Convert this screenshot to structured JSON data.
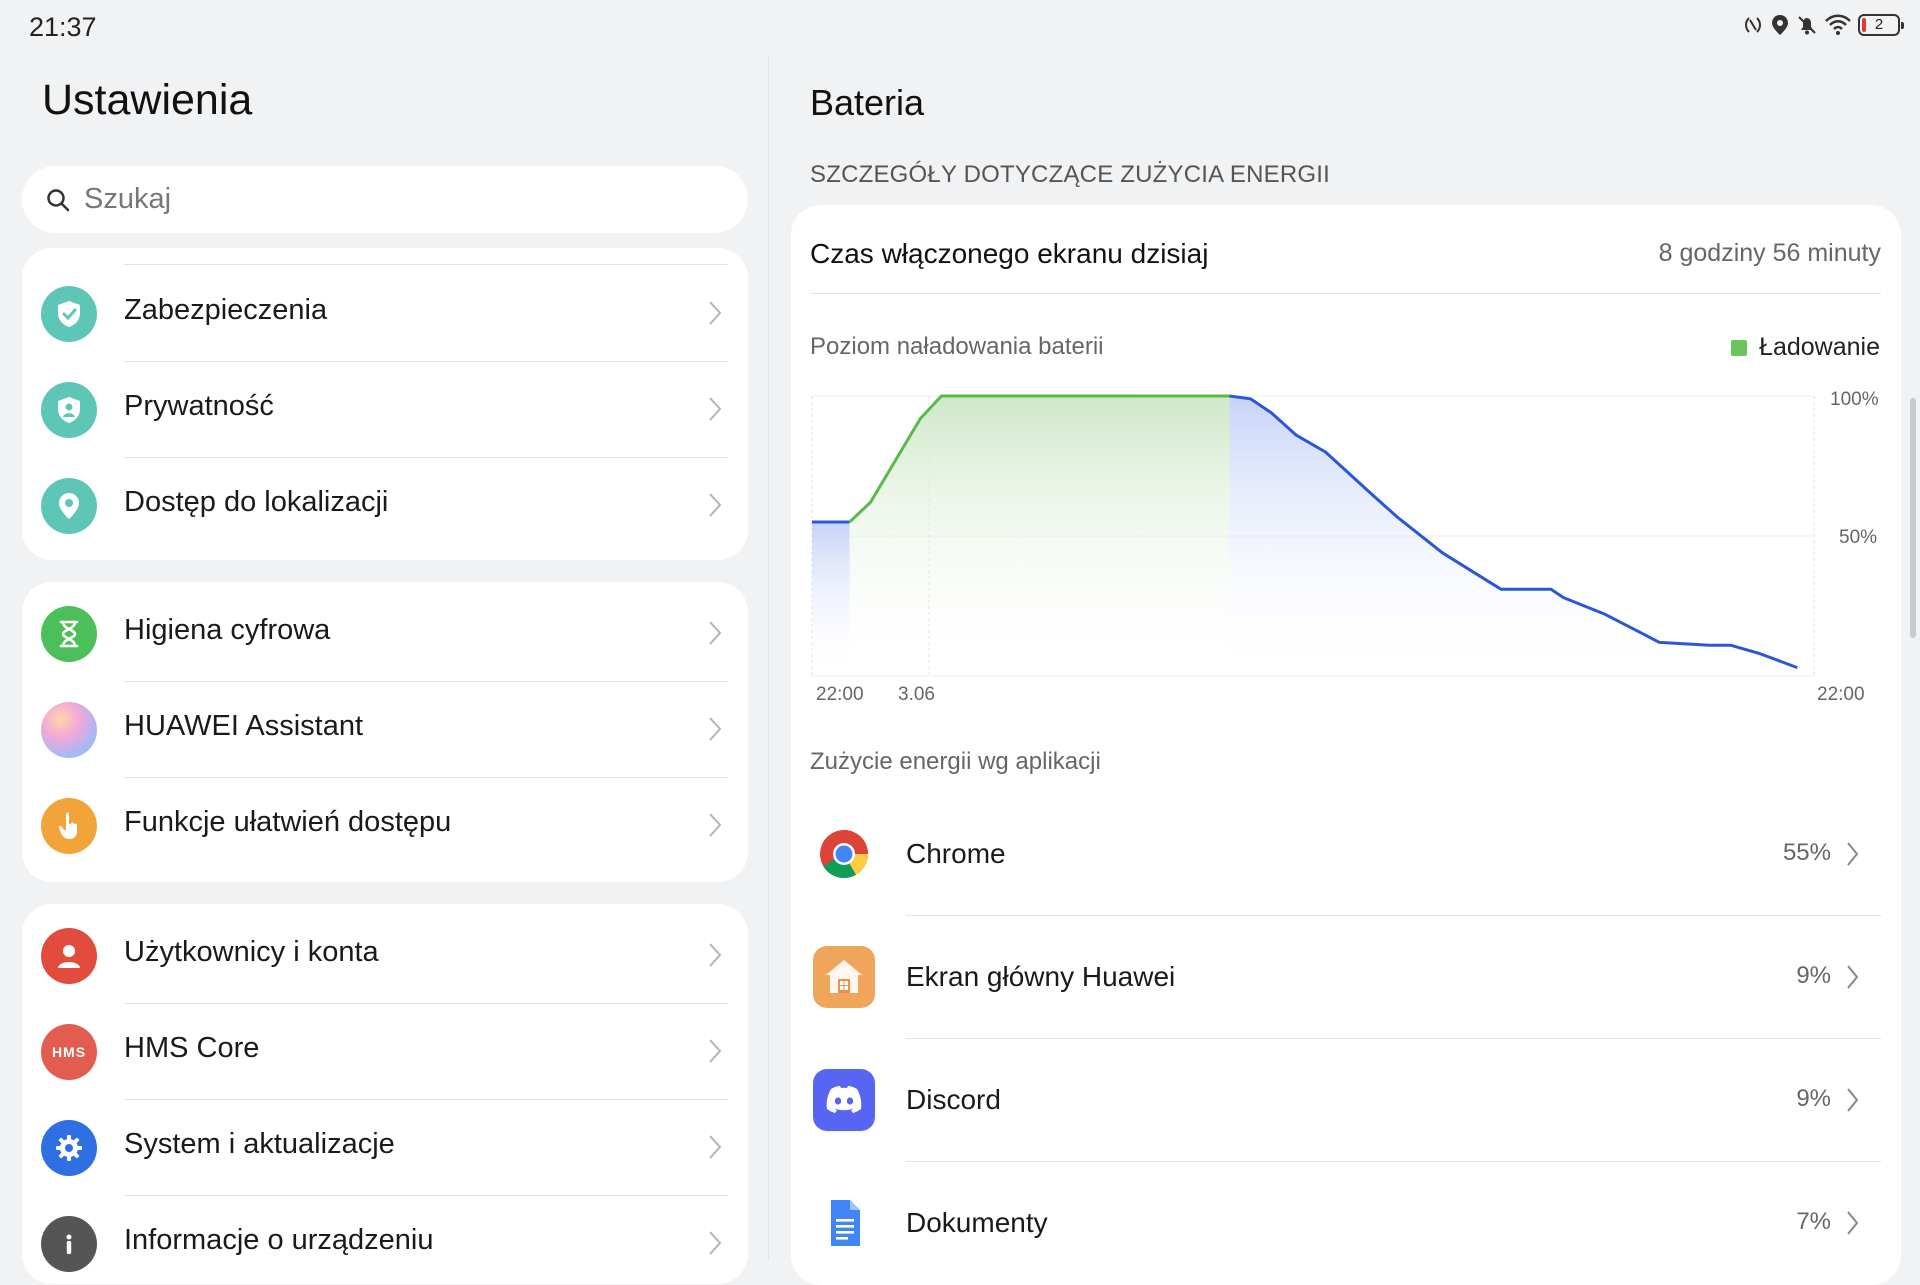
{
  "status": {
    "time": "21:37",
    "battery_level": "2",
    "icons": [
      "nfc-icon",
      "location-icon",
      "mute-icon",
      "wifi-icon",
      "battery-icon"
    ]
  },
  "left": {
    "title": "Ustawienia",
    "search_placeholder": "Szukaj",
    "groups": [
      [
        {
          "label": "Zabezpieczenia",
          "icon": "shield-check-icon",
          "color": "#5ec6b7"
        },
        {
          "label": "Prywatność",
          "icon": "privacy-shield-icon",
          "color": "#5ec6b7"
        },
        {
          "label": "Dostęp do lokalizacji",
          "icon": "location-pin-icon",
          "color": "#5ec6b7"
        }
      ],
      [
        {
          "label": "Higiena cyfrowa",
          "icon": "hourglass-icon",
          "color": "#4dbf5a"
        },
        {
          "label": "HUAWEI Assistant",
          "icon": "assistant-orb-icon",
          "color": "#c9b6f2"
        },
        {
          "label": "Funkcje ułatwień dostępu",
          "icon": "hand-icon",
          "color": "#f2a43a"
        }
      ],
      [
        {
          "label": "Użytkownicy i konta",
          "icon": "user-icon",
          "color": "#e24c3e"
        },
        {
          "label": "HMS Core",
          "icon": "hms-icon",
          "color": "#e24c3e"
        },
        {
          "label": "System i aktualizacje",
          "icon": "gear-icon",
          "color": "#2f6fe4"
        },
        {
          "label": "Informacje o urządzeniu",
          "icon": "info-icon",
          "color": "#555555"
        }
      ]
    ]
  },
  "right": {
    "title": "Bateria",
    "section_header": "SZCZEGÓŁY DOTYCZĄCE ZUŻYCIA ENERGII",
    "screen_time_label": "Czas włączonego ekranu dzisiaj",
    "screen_time_value": "8 godziny 56 minuty",
    "chart_title": "Poziom naładowania baterii",
    "legend_label": "Ładowanie",
    "apps_header": "Zużycie energii wg aplikacji",
    "apps": [
      {
        "name": "Chrome",
        "percent": "55%",
        "icon": "chrome-icon"
      },
      {
        "name": "Ekran główny Huawei",
        "percent": "9%",
        "icon": "home-icon"
      },
      {
        "name": "Discord",
        "percent": "9%",
        "icon": "discord-icon"
      },
      {
        "name": "Dokumenty",
        "percent": "7%",
        "icon": "docs-icon"
      }
    ]
  },
  "chart_data": {
    "type": "area",
    "title": "Poziom naładowania baterii",
    "legend": [
      "Ładowanie"
    ],
    "x_tick_labels": [
      "22:00",
      "3.06",
      "22:00"
    ],
    "y_tick_labels": [
      "100%",
      "50%"
    ],
    "ylim": [
      0,
      100
    ],
    "x_hours": [
      0,
      0.9,
      1.4,
      2.6,
      3.1,
      10.0,
      10.5,
      11.0,
      11.6,
      12.3,
      13.4,
      14.0,
      15.1,
      16.5,
      17.7,
      18.0,
      19.0,
      20.3,
      21.5,
      22.0,
      22.7,
      23.6
    ],
    "values": [
      55,
      55,
      62,
      92,
      100,
      100,
      99,
      94,
      86,
      80,
      65,
      57,
      44,
      31,
      31,
      28,
      22,
      12,
      11,
      11,
      8,
      3
    ],
    "charging_range_hours": [
      0.9,
      10.0
    ],
    "colors": {
      "line": "#2b57d6",
      "charging_line": "#5cb84c",
      "charging_fill": "#cfe8c8",
      "discharge_fill": "#c4d1f7"
    },
    "grid": true
  }
}
